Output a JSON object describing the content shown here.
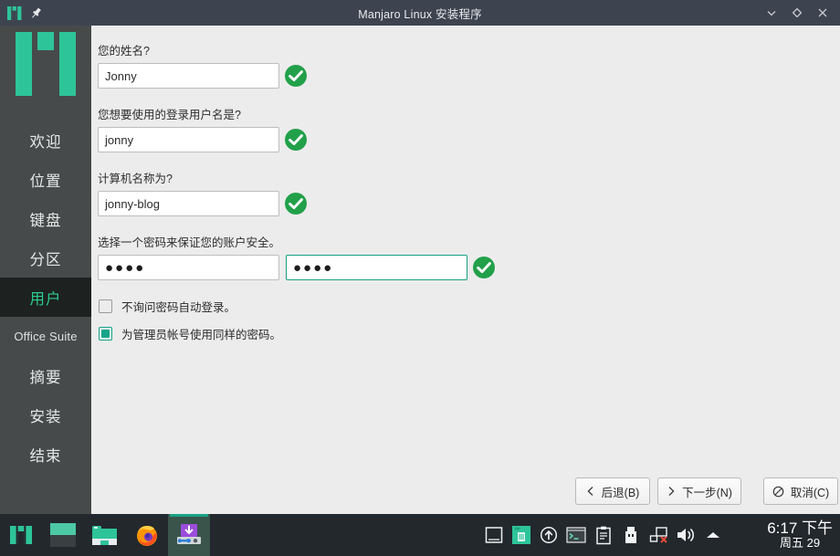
{
  "window": {
    "title": "Manjaro Linux 安装程序",
    "logo_icon": "manjaro-logo-icon",
    "pin_icon": "pin-icon",
    "controls": {
      "minimize_icon": "chevron-down-icon",
      "maximize_icon": "diamond-icon",
      "close_icon": "close-icon"
    }
  },
  "sidebar": {
    "logo_icon": "manjaro-logo-icon",
    "items": [
      {
        "label": "欢迎",
        "name": "welcome",
        "active": false
      },
      {
        "label": "位置",
        "name": "location",
        "active": false
      },
      {
        "label": "键盘",
        "name": "keyboard",
        "active": false
      },
      {
        "label": "分区",
        "name": "partitions",
        "active": false
      },
      {
        "label": "用户",
        "name": "users",
        "active": true
      },
      {
        "label": "Office Suite",
        "name": "office-suite",
        "active": false
      },
      {
        "label": "摘要",
        "name": "summary",
        "active": false
      },
      {
        "label": "安装",
        "name": "install",
        "active": false
      },
      {
        "label": "结束",
        "name": "finish",
        "active": false
      }
    ]
  },
  "form": {
    "fullname": {
      "label": "您的姓名?",
      "value": "Jonny",
      "placeholder": "",
      "valid_icon": "check-circle-icon"
    },
    "username": {
      "label": "您想要使用的登录用户名是?",
      "value": "jonny",
      "placeholder": "",
      "valid_icon": "check-circle-icon"
    },
    "hostname": {
      "label": "计算机名称为?",
      "value": "jonny-blog",
      "placeholder": "",
      "valid_icon": "check-circle-icon"
    },
    "password": {
      "label": "选择一个密码来保证您的账户安全。",
      "value": "●●●●",
      "confirm_value": "●●●●",
      "placeholder": "",
      "valid_icon": "check-circle-icon"
    },
    "checkboxes": [
      {
        "label": "不询问密码自动登录。",
        "checked": false,
        "name": "autologin"
      },
      {
        "label": "为管理员帐号使用同样的密码。",
        "checked": true,
        "name": "same-admin-password"
      }
    ]
  },
  "footer": {
    "back": {
      "label": "后退(B)",
      "icon": "chevron-left-icon"
    },
    "next": {
      "label": "下一步(N)",
      "icon": "chevron-right-icon"
    },
    "cancel": {
      "label": "取消(C)",
      "icon": "cancel-icon"
    }
  },
  "taskbar": {
    "launchers": [
      {
        "name": "manjaro-menu",
        "icon": "manjaro-logo-icon"
      },
      {
        "name": "show-desktop",
        "icon": "desktop-icon"
      },
      {
        "name": "file-manager",
        "icon": "folder-icon"
      },
      {
        "name": "firefox",
        "icon": "firefox-icon"
      },
      {
        "name": "installer",
        "icon": "installer-icon",
        "active": true
      }
    ],
    "tray": [
      {
        "name": "window-list",
        "icon": "window-icon"
      },
      {
        "name": "trash",
        "icon": "trash-icon"
      },
      {
        "name": "updates",
        "icon": "update-arrow-icon"
      },
      {
        "name": "terminal",
        "icon": "terminal-icon"
      },
      {
        "name": "clipboard",
        "icon": "clipboard-icon"
      },
      {
        "name": "usb-device",
        "icon": "usb-icon"
      },
      {
        "name": "network-offline",
        "icon": "network-disconnected-icon"
      },
      {
        "name": "volume",
        "icon": "speaker-icon"
      },
      {
        "name": "show-hidden",
        "icon": "chevron-up-icon"
      }
    ],
    "clock": {
      "time": "6:17 下午",
      "date": "周五 29"
    }
  },
  "colors": {
    "accent": "#16a085",
    "titlebar": "#3d4450",
    "sidebar": "#474a4a",
    "sidebar_active_bg": "#1d2220",
    "sidebar_active_text": "#2ecc8f",
    "content_bg": "#ececec",
    "valid_green": "#22a04a",
    "taskbar": "#23282d"
  }
}
